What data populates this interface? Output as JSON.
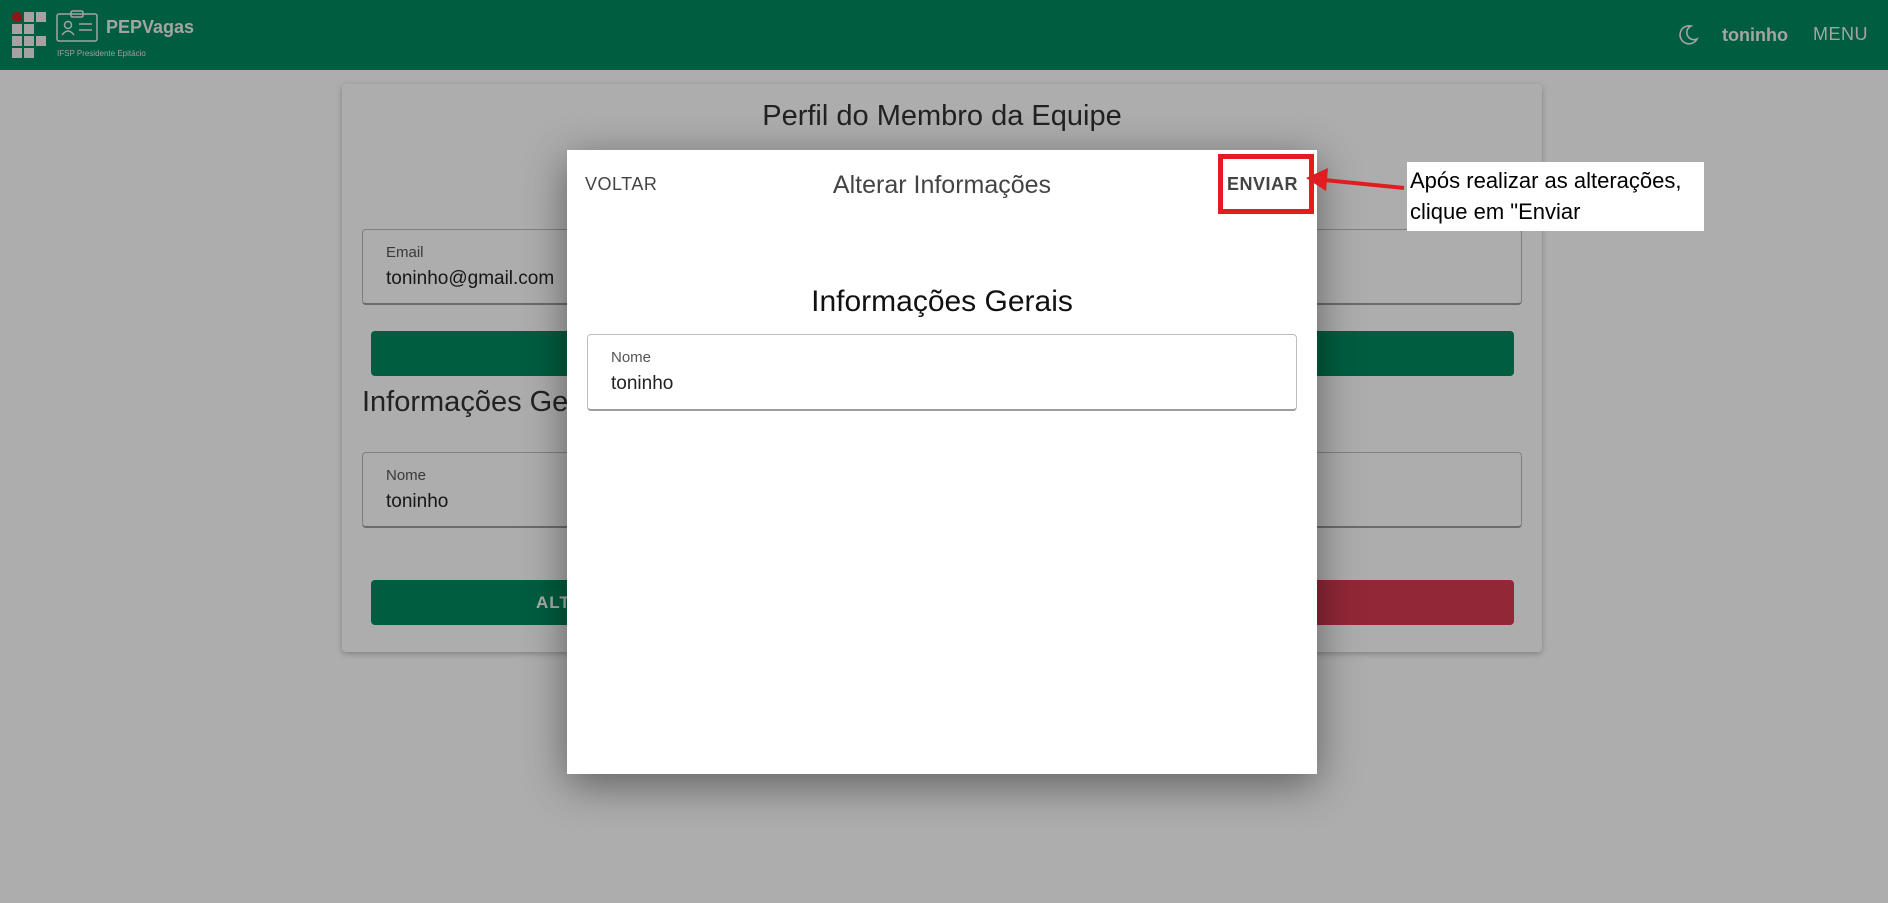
{
  "header": {
    "brand": "PEPVagas",
    "subtitle": "IFSP Presidente Epitácio",
    "user": "toninho",
    "menu_label": "MENU"
  },
  "profile": {
    "title": "Perfil do Membro da Equipe",
    "email_label": "Email",
    "email_value": "toninho@gmail.com",
    "section_title": "Informações Gerais",
    "name_label": "Nome",
    "name_value": "toninho",
    "alter_label": "ALTERAR"
  },
  "dialog": {
    "back_label": "VOLTAR",
    "title": "Alterar Informações",
    "send_label": "ENVIAR",
    "section_title": "Informações Gerais",
    "name_label": "Nome",
    "name_value": "toninho"
  },
  "annotation": {
    "line1": "Após realizar as alterações,",
    "line2": "clique em \"Enviar"
  },
  "colors": {
    "brand_green": "#00895e",
    "danger_red": "#d63a52",
    "highlight_red": "#e11d22"
  }
}
